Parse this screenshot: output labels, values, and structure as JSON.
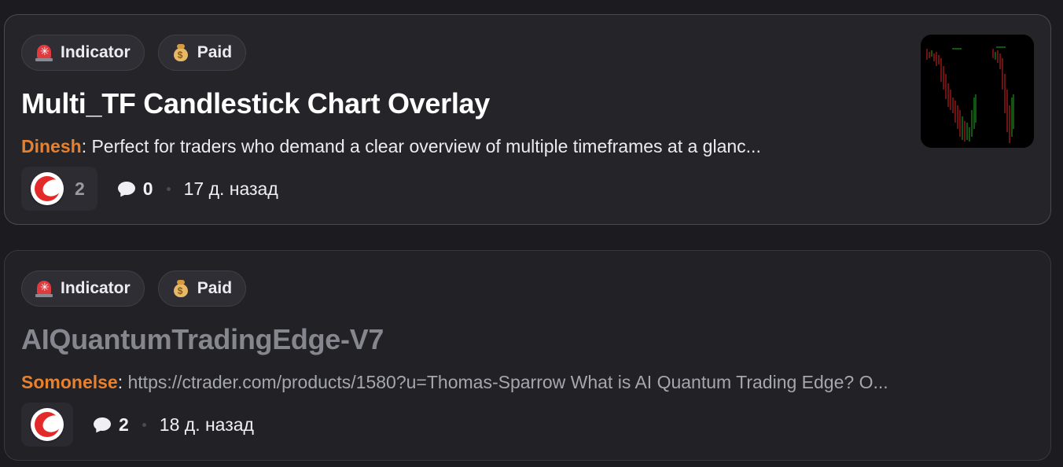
{
  "posts": [
    {
      "tags": [
        {
          "label": "Indicator",
          "icon": "siren-icon"
        },
        {
          "label": "Paid",
          "icon": "moneybag-icon"
        }
      ],
      "title": "Multi_TF Candlestick Chart Overlay",
      "author": "Dinesh",
      "excerpt": "Perfect for traders who demand a clear overview of multiple timeframes at a glanc...",
      "likes": "2",
      "comments": "0",
      "time_ago": "17 д. назад",
      "has_thumbnail": true
    },
    {
      "tags": [
        {
          "label": "Indicator",
          "icon": "siren-icon"
        },
        {
          "label": "Paid",
          "icon": "moneybag-icon"
        }
      ],
      "title": "AIQuantumTradingEdge-V7",
      "author": "Somonelse",
      "excerpt": "https://ctrader.com/products/1580?u=Thomas-Sparrow What is AI Quantum Trading Edge? O...",
      "likes": "",
      "comments": "2",
      "time_ago": "18 д. назад",
      "has_thumbnail": false
    }
  ],
  "colors": {
    "author": "#e8812f",
    "background": "#1c1c20",
    "card": "#242429",
    "title_read": "#86868e"
  }
}
